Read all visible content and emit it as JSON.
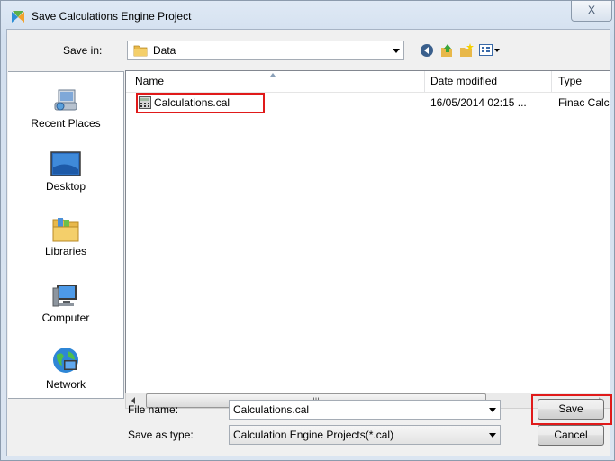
{
  "window": {
    "title": "Save Calculations Engine Project",
    "close_label": "X"
  },
  "toolbar": {
    "save_in_label": "Save in:",
    "save_in_value": "Data",
    "icons": [
      "back-icon",
      "up-folder-icon",
      "new-folder-icon",
      "view-menu-icon"
    ]
  },
  "places": [
    {
      "label": "Recent Places",
      "icon": "recent-places-icon"
    },
    {
      "label": "Desktop",
      "icon": "desktop-icon"
    },
    {
      "label": "Libraries",
      "icon": "libraries-icon"
    },
    {
      "label": "Computer",
      "icon": "computer-icon"
    },
    {
      "label": "Network",
      "icon": "network-icon"
    }
  ],
  "filelist": {
    "columns": [
      "Name",
      "Date modified",
      "Type"
    ],
    "rows": [
      {
        "name": "Calculations.cal",
        "date": "16/05/2014 02:15 ...",
        "type": "Finac Calc"
      }
    ],
    "scroll_grip": "III"
  },
  "form": {
    "file_name_label": "File name:",
    "file_name_value": "Calculations.cal",
    "save_as_type_label": "Save as type:",
    "save_as_type_value": "Calculation Engine Projects(*.cal)"
  },
  "buttons": {
    "save": "Save",
    "cancel": "Cancel"
  },
  "colors": {
    "highlight": "#e01a1a"
  }
}
